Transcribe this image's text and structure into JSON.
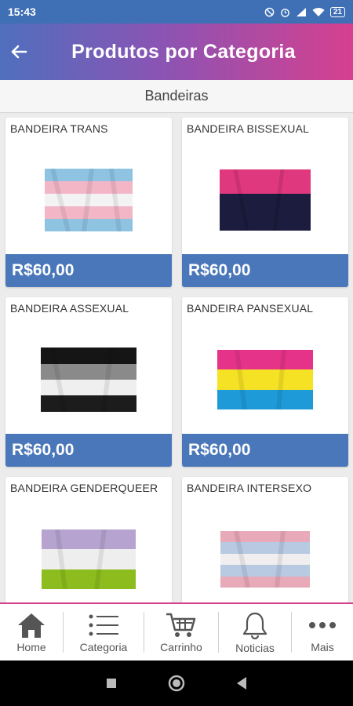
{
  "status": {
    "time": "15:43",
    "battery": "21"
  },
  "header": {
    "title": "Produtos por Categoria"
  },
  "category": {
    "name": "Bandeiras"
  },
  "products": [
    {
      "name": "BANDEIRA TRANS",
      "price": "R$60,00",
      "flag": "trans"
    },
    {
      "name": "BANDEIRA BISSEXUAL",
      "price": "R$60,00",
      "flag": "bissexual"
    },
    {
      "name": "BANDEIRA ASSEXUAL",
      "price": "R$60,00",
      "flag": "assexual"
    },
    {
      "name": "BANDEIRA PANSEXUAL",
      "price": "R$60,00",
      "flag": "pansexual"
    },
    {
      "name": "BANDEIRA GENDERQUEER",
      "price": "",
      "flag": "genderqueer"
    },
    {
      "name": "BANDEIRA INTERSEXO",
      "price": "",
      "flag": "intersexo"
    }
  ],
  "nav": [
    {
      "label": "Home",
      "icon": "home-icon"
    },
    {
      "label": "Categoria",
      "icon": "list-icon"
    },
    {
      "label": "Carrinho",
      "icon": "cart-icon"
    },
    {
      "label": "Noticias",
      "icon": "bell-icon"
    },
    {
      "label": "Mais",
      "icon": "more-icon"
    }
  ],
  "colors": {
    "primary": "#4a77b9",
    "accent": "#d6408f"
  }
}
